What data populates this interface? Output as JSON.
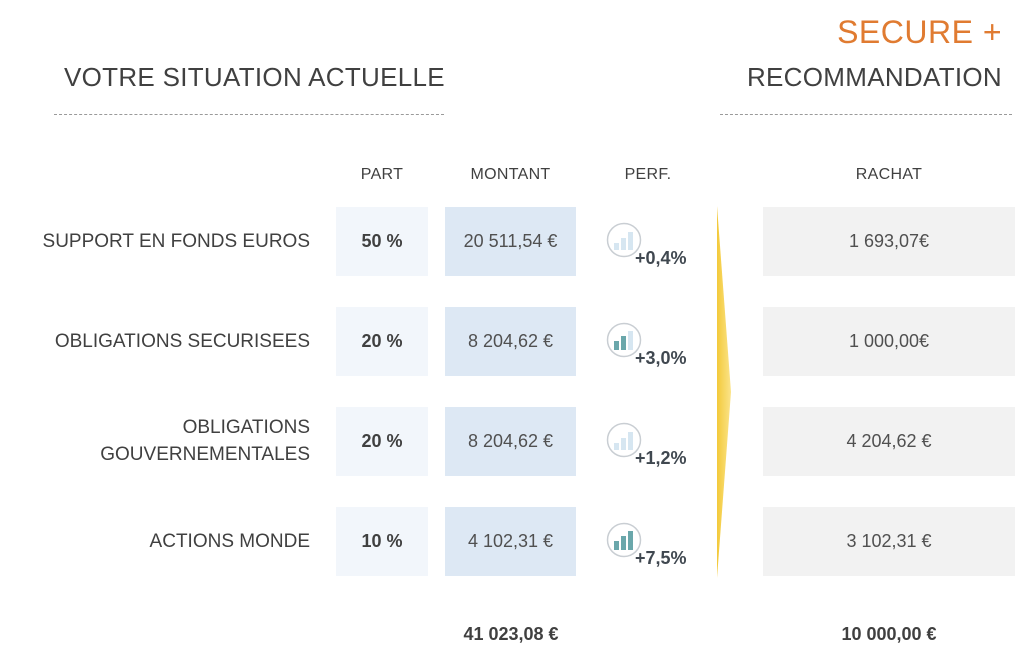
{
  "brand": "SECURE +",
  "left_title": "VOTRE SITUATION ACTUELLE",
  "right_title": "RECOMMANDATION",
  "headers": {
    "part": "PART",
    "montant": "MONTANT",
    "perf": "PERF.",
    "rachat": "RACHAT"
  },
  "rows": [
    {
      "label_lines": [
        "SUPPORT EN FONDS EUROS"
      ],
      "part": "50 %",
      "montant": "20 511,54 €",
      "perf": "+0,4%",
      "perf_icon": "low-performance-bar-icon",
      "rachat": "1 693,07€"
    },
    {
      "label_lines": [
        "OBLIGATIONS SECURISEES"
      ],
      "part": "20 %",
      "montant": "8 204,62 €",
      "perf": "+3,0%",
      "perf_icon": "medium-performance-bar-icon",
      "rachat": "1 000,00€"
    },
    {
      "label_lines": [
        "OBLIGATIONS",
        "GOUVERNEMENTALES"
      ],
      "part": "20 %",
      "montant": "8 204,62 €",
      "perf": "+1,2%",
      "perf_icon": "low-performance-bar-icon",
      "rachat": "4 204,62 €"
    },
    {
      "label_lines": [
        "ACTIONS MONDE"
      ],
      "part": "10 %",
      "montant": "4 102,31 €",
      "perf": "+7,5%",
      "perf_icon": "high-performance-bar-icon",
      "rachat": "3 102,31 €"
    }
  ],
  "totals": {
    "montant": "41 023,08 €",
    "rachat": "10 000,00 €"
  },
  "colors": {
    "brand": "#e07b31",
    "montant_bg": "#dde8f4",
    "part_bg": "#f2f6fb",
    "rachat_bg": "#f2f2f2",
    "arrow": "#f6d24a",
    "bar_strong": "#6aa7ab",
    "bar_light": "#d6e6f1"
  }
}
